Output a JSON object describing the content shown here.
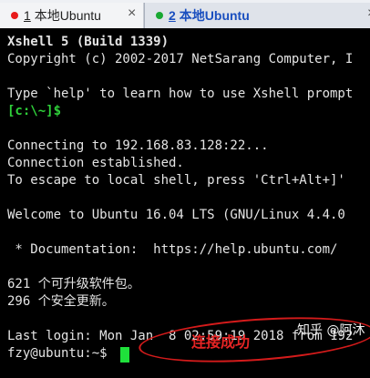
{
  "tabs": [
    {
      "number": "1",
      "label": "本地Ubuntu",
      "status_color": "#e81b1b",
      "close": "×"
    },
    {
      "number": "2",
      "label": "本地Ubuntu",
      "status_color": "#19a832",
      "close": "×"
    }
  ],
  "terminal": {
    "lines": [
      "Xshell 5 (Build 1339)",
      "Copyright (c) 2002-2017 NetSarang Computer, I",
      "",
      "Type `help' to learn how to use Xshell prompt",
      "[c:\\~]$",
      "",
      "Connecting to 192.168.83.128:22...",
      "Connection established.",
      "To escape to local shell, press 'Ctrl+Alt+]'",
      "",
      "Welcome to Ubuntu 16.04 LTS (GNU/Linux 4.4.0",
      "",
      " * Documentation:  https://help.ubuntu.com/",
      "",
      "621 个可升级软件包。",
      "296 个安全更新。",
      "",
      "Last login: Mon Jan  8 02:59:19 2018 from 192",
      "fzy@ubuntu:~$ "
    ]
  },
  "watermark": "知乎 @阿沐",
  "annotation": "连接成功",
  "colors": {
    "terminal_bg": "#000000",
    "terminal_fg": "#e4e4e4",
    "prompt": "#2fd03a",
    "cursor": "#1fe03b",
    "annotation": "#e52424"
  }
}
